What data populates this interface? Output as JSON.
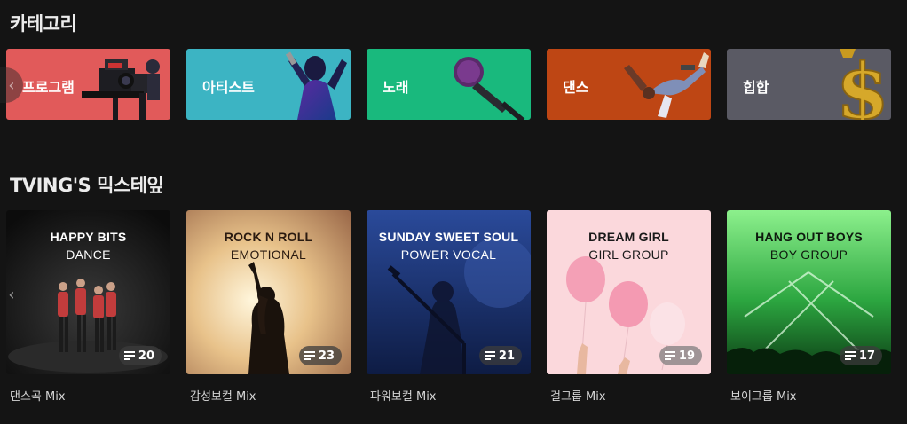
{
  "sections": {
    "category_title": "카테고리",
    "mix_title": "TVING'S 믹스테잎"
  },
  "categories": [
    {
      "label": "프로그램",
      "color": "#e15a5a",
      "icon": "camera-icon"
    },
    {
      "label": "아티스트",
      "color": "#3cb4c3",
      "icon": "singer-icon"
    },
    {
      "label": "노래",
      "color": "#19b97d",
      "icon": "microphone-icon"
    },
    {
      "label": "댄스",
      "color": "#be4614",
      "icon": "dancer-icon"
    },
    {
      "label": "힙합",
      "color": "#5a5a64",
      "icon": "dollar-chain-icon"
    }
  ],
  "mixes": [
    {
      "line1": "HAPPY BITS",
      "line2": "DANCE",
      "count": "20",
      "caption": "댄스곡 Mix"
    },
    {
      "line1": "ROCK N ROLL",
      "line2": "EMOTIONAL",
      "count": "23",
      "caption": "감성보컬 Mix"
    },
    {
      "line1": "SUNDAY SWEET SOUL",
      "line2": "POWER VOCAL",
      "count": "21",
      "caption": "파워보컬 Mix"
    },
    {
      "line1": "DREAM GIRL",
      "line2": "GIRL GROUP",
      "count": "19",
      "caption": "걸그룹 Mix"
    },
    {
      "line1": "HANG OUT BOYS",
      "line2": "BOY GROUP",
      "count": "17",
      "caption": "보이그룹 Mix"
    }
  ],
  "nav": {
    "prev_glyph": "‹"
  }
}
